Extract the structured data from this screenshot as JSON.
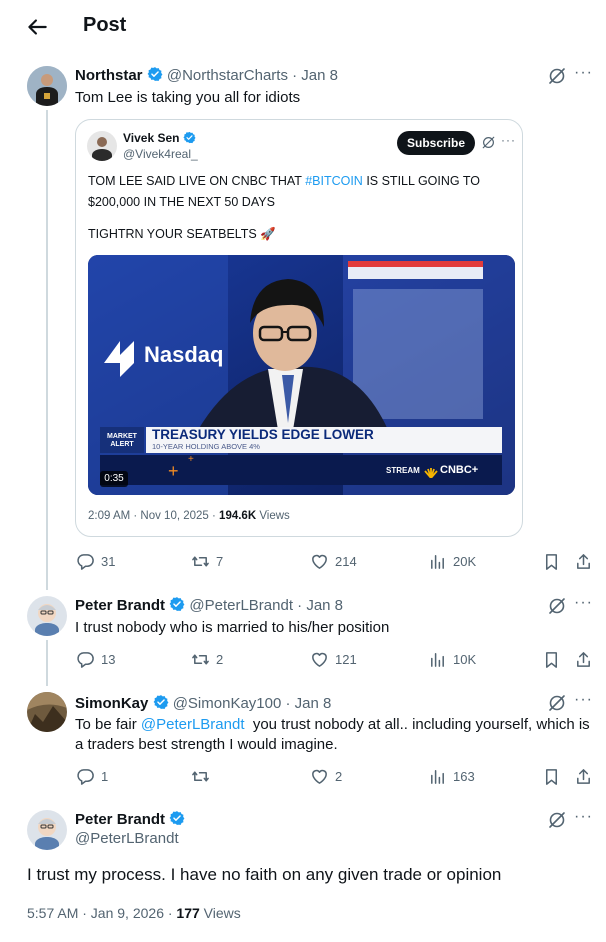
{
  "header": {
    "title": "Post"
  },
  "post1": {
    "name": "Northstar",
    "handle": "@NorthstarCharts",
    "date": "· Jan 8",
    "text": "Tom Lee is taking you all for idiots",
    "quote": {
      "name": "Vivek Sen",
      "handle": "@Vivek4real_",
      "subscribe": "Subscribe",
      "text_a": "TOM LEE SAID LIVE ON CNBC THAT ",
      "hashtag": "#BITCOIN",
      "text_b": " IS STILL GOING TO $200,000 IN THE NEXT 50 DAYS",
      "text2": "TIGHTRN YOUR SEATBELTS 🚀",
      "video": {
        "nasdaq": "Nasdaq",
        "alert_l1": "MARKET",
        "alert_l2": "ALERT",
        "headline": "TREASURY YIELDS EDGE LOWER",
        "subline": "10-YEAR HOLDING ABOVE 4%",
        "stream": "STREAM",
        "network": "CNBC+",
        "duration": "0:35"
      },
      "meta_time": "2:09 AM · Nov 10, 2025 · ",
      "meta_views": "194.6K",
      "meta_views_label": " Views"
    },
    "stats": {
      "replies": "31",
      "reposts": "7",
      "likes": "214",
      "views": "20K"
    }
  },
  "post2": {
    "name": "Peter Brandt",
    "handle": "@PeterLBrandt",
    "date": "· Jan 8",
    "text": "I trust nobody who is married to his/her position",
    "stats": {
      "replies": "13",
      "reposts": "2",
      "likes": "121",
      "views": "10K"
    }
  },
  "post3": {
    "name": "SimonKay",
    "handle": "@SimonKay100",
    "date": "· Jan 8",
    "text_a": "To be fair ",
    "mention": "@PeterLBrandt",
    "text_b": "  you trust nobody at all.. including yourself, which is a traders best strength I would imagine.",
    "stats": {
      "replies": "1",
      "reposts": "",
      "likes": "2",
      "views": "163"
    }
  },
  "post4": {
    "name": "Peter Brandt",
    "handle": "@PeterLBrandt",
    "text": "I trust my process. I have no faith on any given trade or opinion",
    "meta_time": "5:57 AM · Jan 9, 2026 · ",
    "meta_views": "177",
    "meta_views_label": " Views"
  },
  "colors": {
    "accent": "#1d9bf0",
    "verified": "#1d9bf0",
    "text": "#0f1419",
    "muted": "#536471"
  },
  "icons": [
    "back-arrow-icon",
    "verified-icon",
    "grok-icon",
    "more-icon",
    "reply-icon",
    "repost-icon",
    "like-icon",
    "views-icon",
    "bookmark-icon",
    "share-icon",
    "rocket-icon"
  ]
}
